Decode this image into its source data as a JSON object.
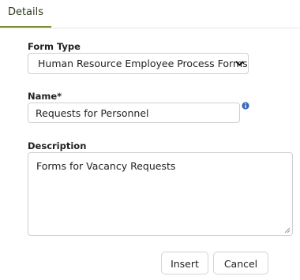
{
  "tabs": {
    "details_label": "Details"
  },
  "form": {
    "form_type": {
      "label": "Form Type",
      "value": "Human Resource Employee Process Forms"
    },
    "name": {
      "label": "Name*",
      "value": "Requests for Personnel"
    },
    "description": {
      "label": "Description",
      "value": "Forms for Vacancy Requests"
    }
  },
  "buttons": {
    "insert_label": "Insert",
    "cancel_label": "Cancel"
  },
  "colors": {
    "accent": "#7d8a2e",
    "info_icon": "#3a68b8"
  }
}
